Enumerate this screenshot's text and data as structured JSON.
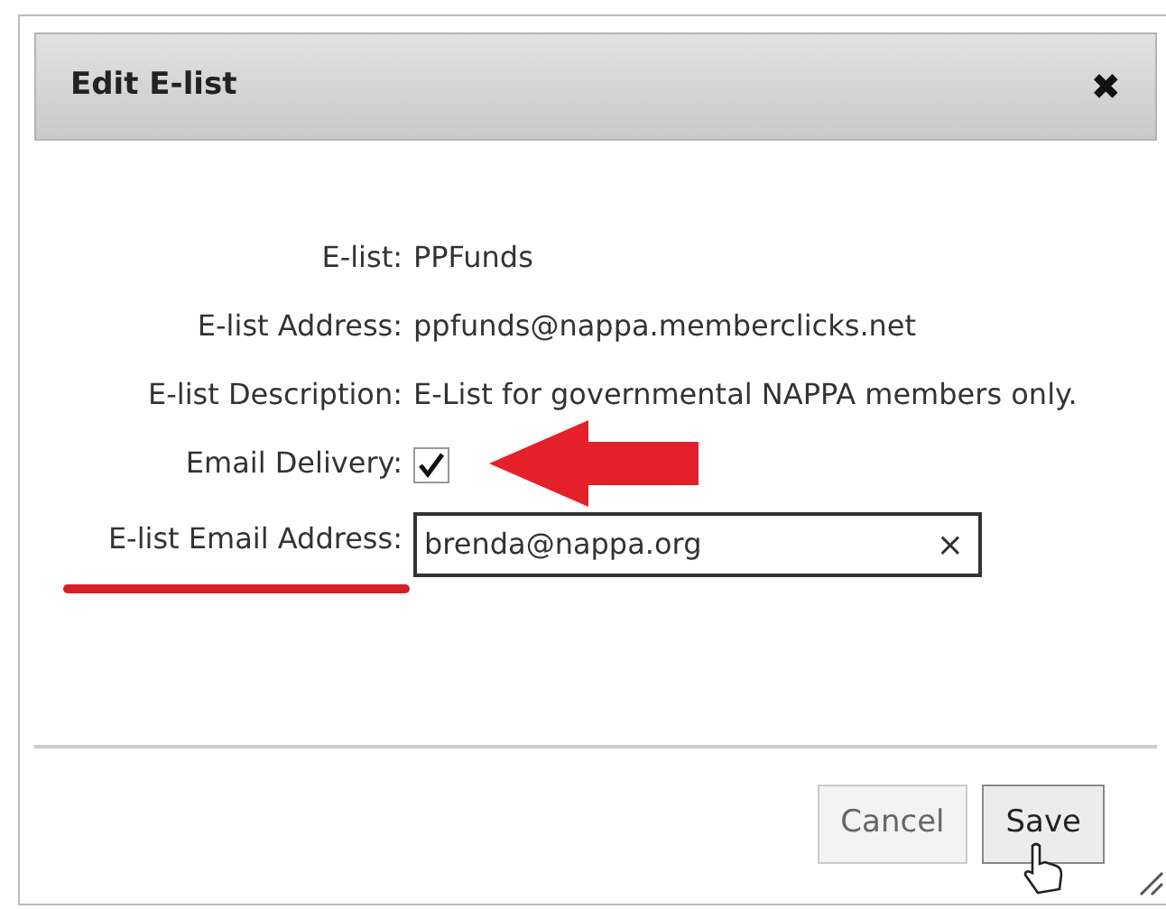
{
  "dialog": {
    "title": "Edit E-list",
    "close": "✖"
  },
  "fields": [
    {
      "kind": "text",
      "label": "E-list:",
      "value": "PPFunds"
    },
    {
      "kind": "text",
      "label": "E-list Address:",
      "value": "ppfunds@nappa.memberclicks.net"
    },
    {
      "kind": "text",
      "label": "E-list Description:",
      "value": "E-List for governmental NAPPA members only."
    },
    {
      "kind": "checkbox",
      "label": "Email Delivery:",
      "checked": true
    },
    {
      "kind": "input",
      "label": "E-list Email Address:",
      "value": "brenda@nappa.org",
      "clear": "×"
    }
  ],
  "buttons": [
    {
      "label": "Cancel",
      "kind": "secondary"
    },
    {
      "label": "Save",
      "kind": "primary"
    }
  ]
}
